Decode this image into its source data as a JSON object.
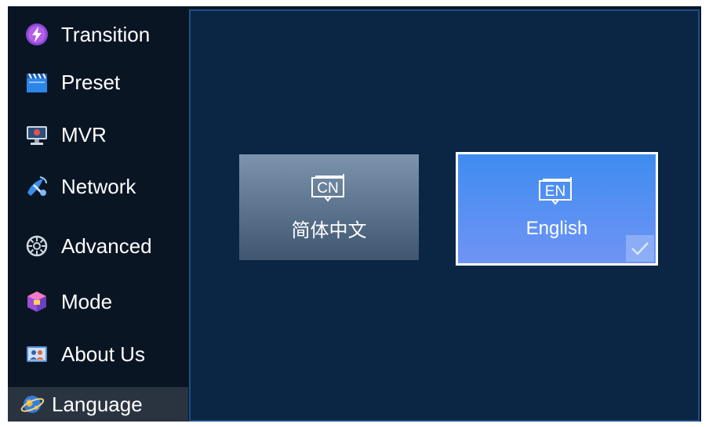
{
  "sidebar": {
    "items": [
      {
        "label": "Transition",
        "icon": "transition-icon"
      },
      {
        "label": "Preset",
        "icon": "clapperboard-icon"
      },
      {
        "label": "MVR",
        "icon": "monitor-icon"
      },
      {
        "label": "Network",
        "icon": "satellite-icon"
      },
      {
        "label": "Advanced",
        "icon": "gear-icon"
      },
      {
        "label": "Mode",
        "icon": "cube-icon"
      },
      {
        "label": "About Us",
        "icon": "people-icon"
      },
      {
        "label": "Language",
        "icon": "globe-icon",
        "active": true
      }
    ]
  },
  "language": {
    "options": [
      {
        "badge": "CN",
        "label": "简体中文",
        "selected": false
      },
      {
        "badge": "EN",
        "label": "English",
        "selected": true
      }
    ]
  },
  "colors": {
    "sidebar_bg": "#0a1524",
    "sidebar_active_bg": "#2a3441",
    "main_bg": "#0b2544",
    "main_border": "#1f4f87",
    "selected_card": "#4a8ff2",
    "unselected_card": "#5f7690"
  }
}
